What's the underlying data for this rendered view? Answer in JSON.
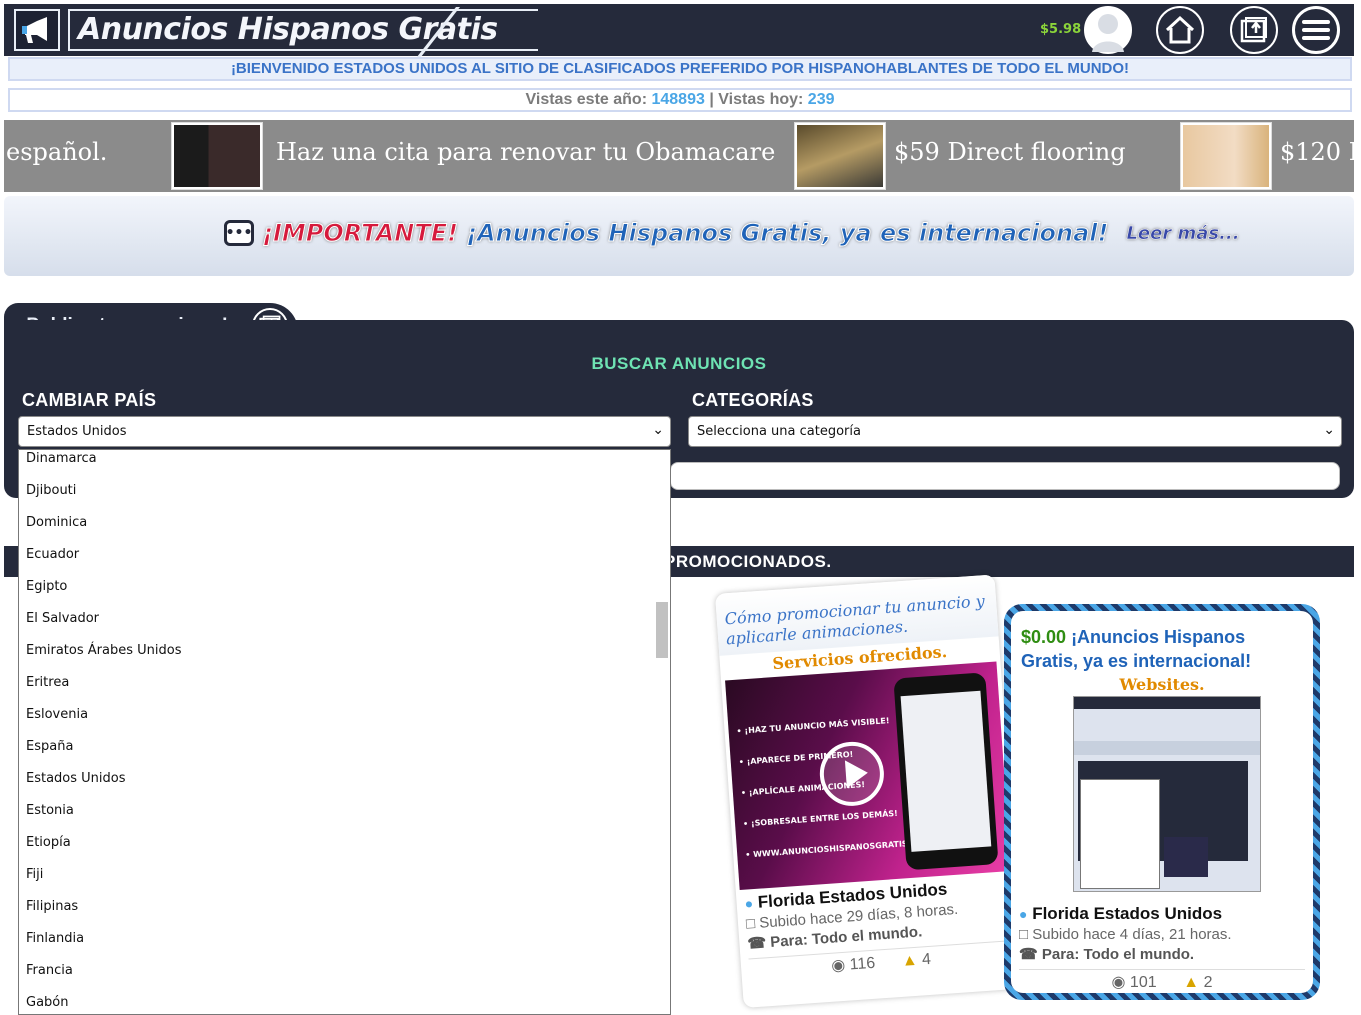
{
  "header": {
    "logo_text": "Anuncios Hispanos Gratis",
    "credit": "$5.98"
  },
  "welcome": "¡BIENVENIDO ESTADOS UNIDOS AL SITIO DE CLASIFICADOS PREFERIDO POR HISPANOHABLANTES DE TODO EL MUNDO!",
  "stats": {
    "year_label": "Vistas este año:",
    "year_value": "148893",
    "sep": "|",
    "today_label": "Vistas hoy:",
    "today_value": "239"
  },
  "ticker": {
    "items": [
      "español.",
      "Haz una cita para renovar tu Obamacare",
      "$59 Direct flooring",
      "$120 I"
    ]
  },
  "important": {
    "tag": "¡IMPORTANTE!",
    "message": "¡Anuncios Hispanos Gratis, ya es internacional!",
    "more": "Leer más..."
  },
  "publish": {
    "label": "¡Publica tu anuncio ya!"
  },
  "search": {
    "title": "BUSCAR ANUNCIOS",
    "country_label": "CAMBIAR PAÍS",
    "country_value": "Estados Unidos",
    "category_label": "CATEGORÍAS",
    "category_value": "Selecciona una categoría"
  },
  "promo": {
    "title_visible": "PROMOCIONADOS."
  },
  "cards": [
    {
      "headline": "Cómo promocionar tu anuncio y aplicarle animaciones.",
      "subtitle": "Servicios ofrecidos.",
      "bullets": [
        "• ¡HAZ TU ANUNCIO MÁS VISIBLE!",
        "• ¡APARECE DE PRIMERO!",
        "• ¡APLÍCALE ANIMACIONES!",
        "• ¡SOBRESALE ENTRE LOS DEMÁS!",
        "• WWW.ANUNCIOSHISPANOSGRATIS.COM"
      ],
      "location": "Florida Estados Unidos",
      "uploaded": "Subido hace 29 días, 8 horas.",
      "para": "Para: Todo el mundo.",
      "views": "116",
      "likes": "4"
    },
    {
      "price": "$0.00",
      "headline": "¡Anuncios Hispanos Gratis, ya es internacional!",
      "subtitle": "Websites.",
      "location": "Florida Estados Unidos",
      "uploaded": "Subido hace 4 días, 21 horas.",
      "para": "Para: Todo el mundo.",
      "views": "101",
      "likes": "2"
    }
  ],
  "dropdown": {
    "options": [
      "Dinamarca",
      "Djibouti",
      "Dominica",
      "Ecuador",
      "Egipto",
      "El Salvador",
      "Emiratos Árabes Unidos",
      "Eritrea",
      "Eslovenia",
      "España",
      "Estados Unidos",
      "Estonia",
      "Etiopía",
      "Fiji",
      "Filipinas",
      "Finlandia",
      "Francia",
      "Gabón"
    ]
  },
  "colors": {
    "header_bg": "#252a3b",
    "accent_green": "#6ee3b3",
    "link_blue": "#4aa6e6",
    "important_red": "#d61a3c"
  }
}
